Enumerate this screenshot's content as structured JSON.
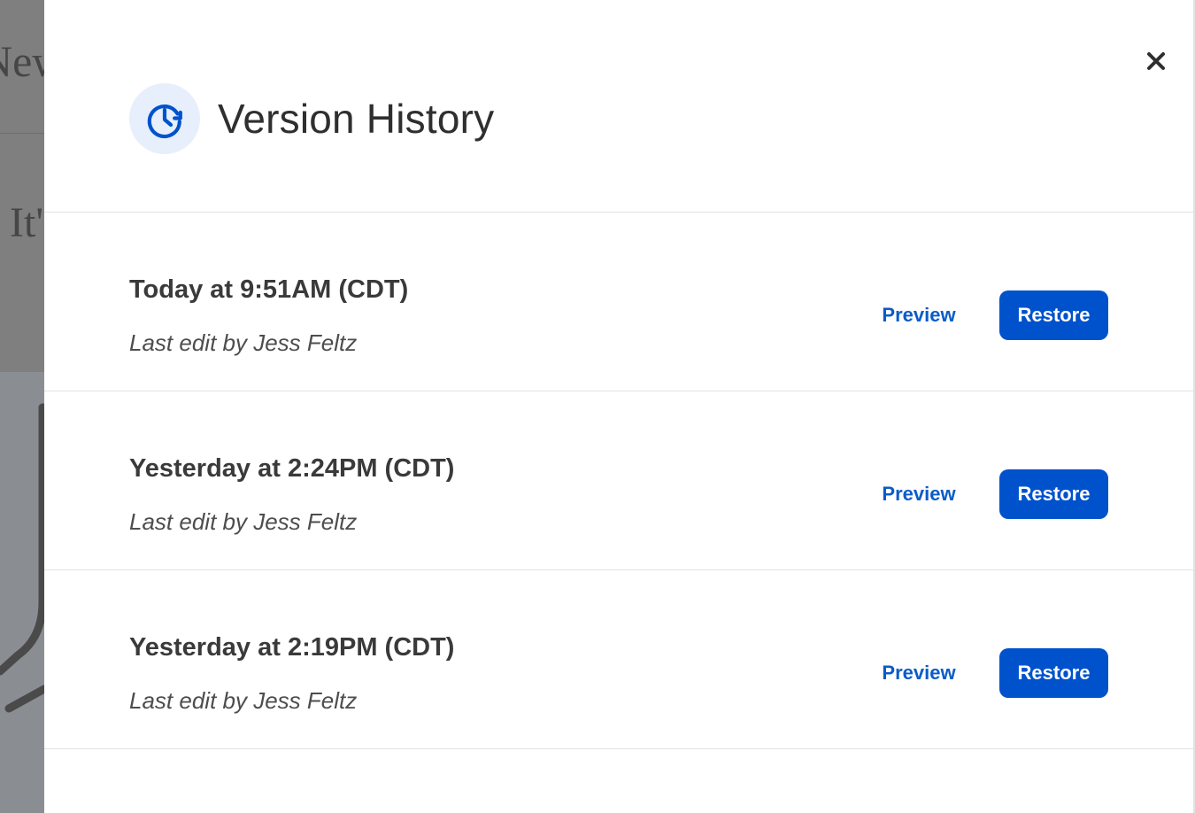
{
  "background": {
    "heading_fragment": "New",
    "text_fragment": "It'"
  },
  "drawer": {
    "title": "Version History",
    "icon": "clock-history-icon",
    "close_icon": "close-icon",
    "versions": [
      {
        "timestamp": "Today at 9:51AM (CDT)",
        "editor": "Last edit by Jess Feltz",
        "preview_label": "Preview",
        "restore_label": "Restore"
      },
      {
        "timestamp": "Yesterday at 2:24PM (CDT)",
        "editor": "Last edit by Jess Feltz",
        "preview_label": "Preview",
        "restore_label": "Restore"
      },
      {
        "timestamp": "Yesterday at 2:19PM (CDT)",
        "editor": "Last edit by Jess Feltz",
        "preview_label": "Preview",
        "restore_label": "Restore"
      }
    ]
  },
  "colors": {
    "accent": "#0052cc",
    "link": "#0a5cc7",
    "icon_background": "#e6effb",
    "overlay": "#8c8c8c",
    "divider": "#e1e1e1"
  }
}
